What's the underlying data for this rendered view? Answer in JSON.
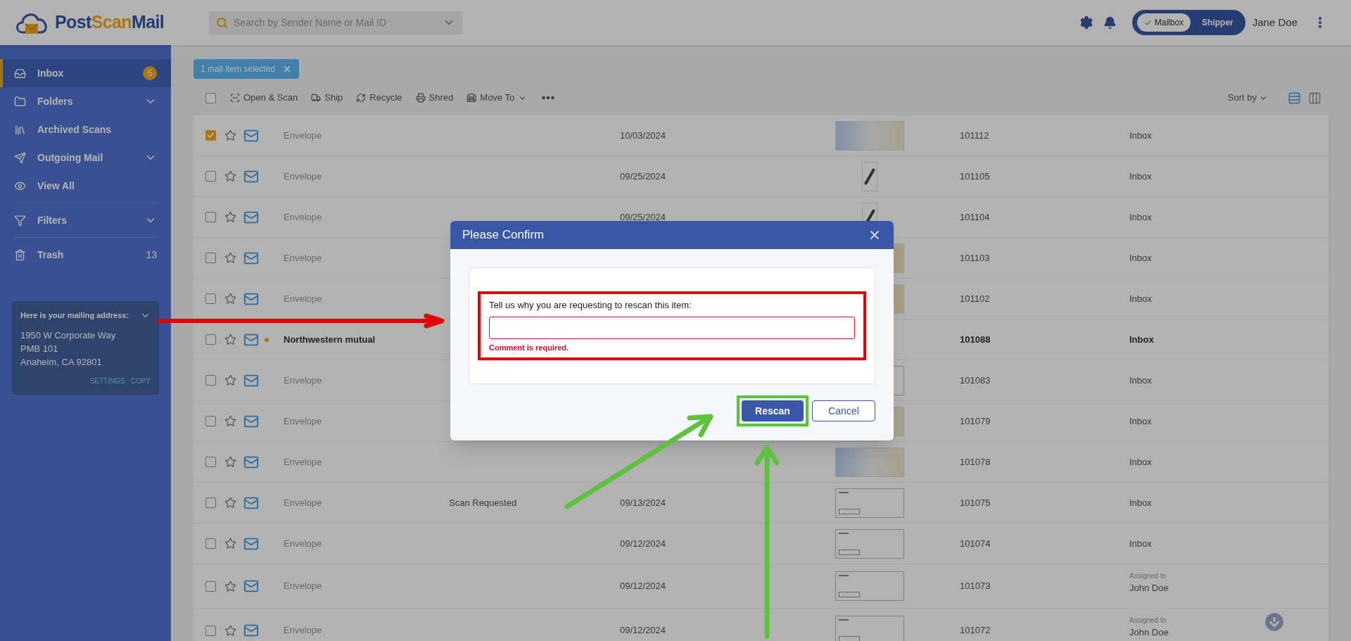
{
  "header": {
    "logo": {
      "first": "Post",
      "middle": "Scan",
      "last": "Mail"
    },
    "search": {
      "placeholder": "Search by Sender Name or Mail ID"
    },
    "mode_toggle": [
      {
        "label": "Mailbox",
        "selected": true
      },
      {
        "label": "Shipper",
        "selected": false
      }
    ],
    "user": "Jane Doe"
  },
  "sidebar": {
    "groups": [
      [
        {
          "label": "Inbox",
          "selected": true,
          "badge": "5",
          "expandable": false
        },
        {
          "label": "Folders",
          "selected": false,
          "expandable": true
        },
        {
          "label": "Archived Scans",
          "selected": false,
          "expandable": false
        },
        {
          "label": "Outgoing Mail",
          "selected": false,
          "expandable": true
        },
        {
          "label": "View All",
          "selected": false,
          "expandable": false
        }
      ],
      [
        {
          "label": "Filters",
          "selected": false,
          "expandable": true
        }
      ],
      [
        {
          "label": "Trash",
          "selected": false,
          "count": "13",
          "expandable": false
        }
      ]
    ],
    "address_card": {
      "title": "Here is your mailing address:",
      "lines": [
        "1950 W Corporate Way",
        "PMB 101",
        "Anaheim, CA 92801"
      ],
      "links": [
        "SETTINGS",
        "COPY"
      ]
    }
  },
  "selection_chip": "1 mail item selected",
  "toolbar": {
    "select_all_checked": false,
    "actions": [
      "Open & Scan",
      "Ship",
      "Recycle",
      "Shred",
      "Move To"
    ],
    "sort_label": "Sort by",
    "views": [
      {
        "kind": "list",
        "selected": true
      },
      {
        "kind": "grid",
        "selected": false
      }
    ]
  },
  "mail_items": [
    {
      "checked": true,
      "starred": false,
      "unread": false,
      "sender": "Envelope",
      "date": "10/03/2024",
      "kind": "envelope",
      "id": "101112",
      "folder": "Inbox"
    },
    {
      "checked": false,
      "starred": false,
      "unread": false,
      "sender": "Envelope",
      "date": "09/25/2024",
      "kind": "pen",
      "id": "101105",
      "folder": "Inbox"
    },
    {
      "checked": false,
      "starred": false,
      "unread": false,
      "sender": "Envelope",
      "date": "09/25/2024",
      "kind": "pen",
      "id": "101104",
      "folder": "Inbox"
    },
    {
      "checked": false,
      "starred": false,
      "unread": false,
      "sender": "Envelope",
      "kind": "tan",
      "id": "101103",
      "folder": "Inbox"
    },
    {
      "checked": false,
      "starred": false,
      "unread": false,
      "sender": "Envelope",
      "kind": "tan",
      "id": "101102",
      "folder": "Inbox"
    },
    {
      "checked": false,
      "starred": false,
      "unread": true,
      "sender": "Northwestern mutual",
      "kind": "none",
      "id": "101088",
      "folder": "Inbox"
    },
    {
      "checked": false,
      "starred": false,
      "unread": false,
      "sender": "Envelope",
      "kind": "letter",
      "id": "101083",
      "folder": "Inbox"
    },
    {
      "checked": false,
      "starred": false,
      "unread": false,
      "sender": "Envelope",
      "kind": "envelope",
      "id": "101079",
      "folder": "Inbox"
    },
    {
      "checked": false,
      "starred": false,
      "unread": false,
      "sender": "Envelope",
      "kind": "envelope",
      "id": "101078",
      "folder": "Inbox"
    },
    {
      "checked": false,
      "starred": false,
      "unread": false,
      "sender": "Envelope",
      "status": "Scan Requested",
      "date": "09/13/2024",
      "kind": "letter",
      "id": "101075",
      "folder": "Inbox"
    },
    {
      "checked": false,
      "starred": false,
      "unread": false,
      "sender": "Envelope",
      "date": "09/12/2024",
      "kind": "letter",
      "id": "101074",
      "folder": "Inbox"
    },
    {
      "checked": false,
      "starred": false,
      "unread": false,
      "sender": "Envelope",
      "date": "09/12/2024",
      "kind": "letter",
      "id": "101073",
      "folder_label": "Assigned to",
      "folder": "John Doe"
    },
    {
      "checked": false,
      "starred": false,
      "unread": false,
      "sender": "Envelope",
      "date": "09/12/2024",
      "kind": "letter",
      "id": "101072",
      "folder_label": "Assigned to",
      "folder": "John Doe"
    }
  ],
  "dialog": {
    "title": "Please Confirm",
    "prompt": "Tell us why you are requesting to rescan this item:",
    "invalid": true,
    "error": "Comment is required.",
    "buttons": [
      {
        "label": "Rescan",
        "kind": "primary"
      },
      {
        "label": "Cancel",
        "kind": "secondary"
      }
    ]
  }
}
